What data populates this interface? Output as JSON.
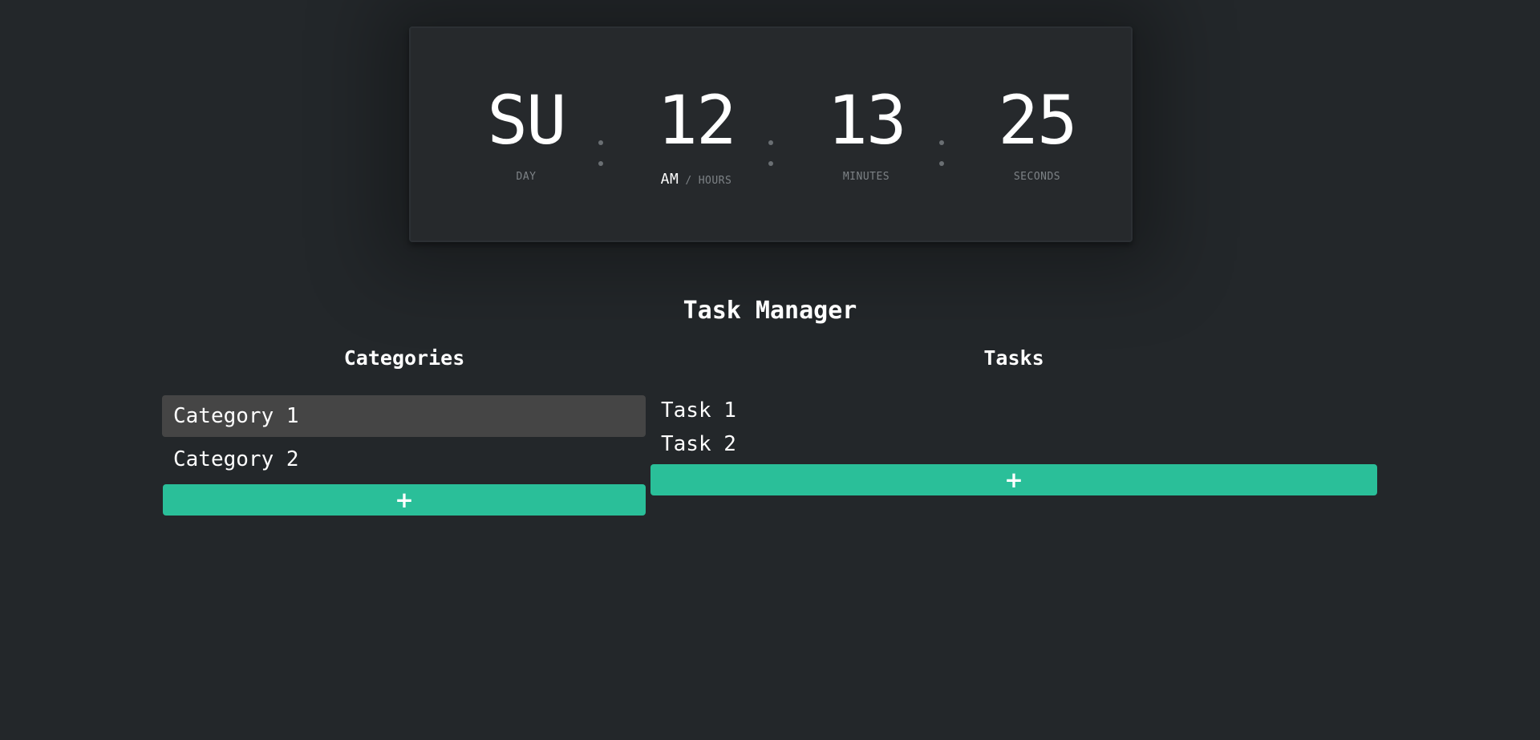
{
  "clock": {
    "day": {
      "value": "SU",
      "label": "DAY"
    },
    "hours": {
      "value": "12",
      "ampm": "AM",
      "separator": "/",
      "label": "HOURS"
    },
    "minutes": {
      "value": "13",
      "label": "MINUTES"
    },
    "seconds": {
      "value": "25",
      "label": "SECONDS"
    }
  },
  "app": {
    "title": "Task Manager",
    "categories_heading": "Categories",
    "tasks_heading": "Tasks"
  },
  "categories": [
    {
      "label": "Category 1",
      "active": true
    },
    {
      "label": "Category 2",
      "active": false
    }
  ],
  "tasks": [
    {
      "label": "Task 1"
    },
    {
      "label": "Task 2"
    }
  ],
  "buttons": {
    "add_category": "+",
    "add_task": "+"
  },
  "colors": {
    "background": "#23272a",
    "accent": "#2abf99",
    "active_item": "#454545"
  }
}
